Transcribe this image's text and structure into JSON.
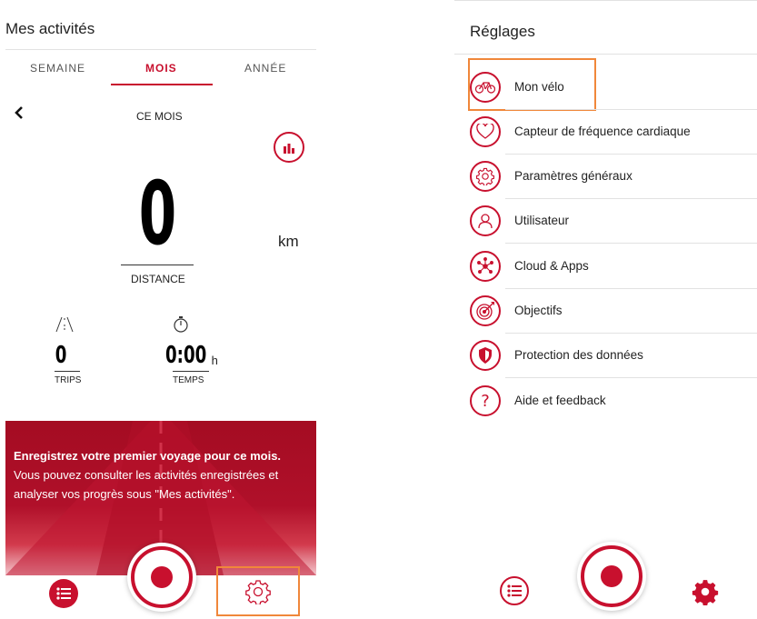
{
  "left": {
    "title": "Mes activités",
    "tabs": [
      {
        "label": "SEMAINE"
      },
      {
        "label": "MOIS",
        "active": true
      },
      {
        "label": "ANNÉE"
      }
    ],
    "period_label": "CE MOIS",
    "distance": {
      "value": "0",
      "unit": "km",
      "label": "DISTANCE"
    },
    "trips": {
      "value": "0",
      "label": "TRIPS"
    },
    "time": {
      "value": "0:00",
      "unit": "h",
      "label": "TEMPS"
    },
    "promo": {
      "heading": "Enregistrez votre premier voyage pour ce mois.",
      "body": "Vous pouvez consulter les activités enregistrées et analyser vos progrès sous \"Mes activités\"."
    },
    "bottom_nav": {
      "list": "list-icon",
      "record": "record-icon",
      "settings": "gear-icon"
    }
  },
  "right": {
    "title": "Réglages",
    "items": [
      {
        "label": "Mon vélo",
        "icon": "bike-icon"
      },
      {
        "label": "Capteur de fréquence cardiaque",
        "icon": "heart-icon"
      },
      {
        "label": "Paramètres généraux",
        "icon": "gear-icon"
      },
      {
        "label": "Utilisateur",
        "icon": "user-icon"
      },
      {
        "label": "Cloud & Apps",
        "icon": "network-icon"
      },
      {
        "label": "Objectifs",
        "icon": "target-icon"
      },
      {
        "label": "Protection des données",
        "icon": "shield-icon"
      },
      {
        "label": "Aide et feedback",
        "icon": "help-icon"
      }
    ]
  },
  "colors": {
    "accent": "#c8102e",
    "highlight": "#f0873a"
  }
}
